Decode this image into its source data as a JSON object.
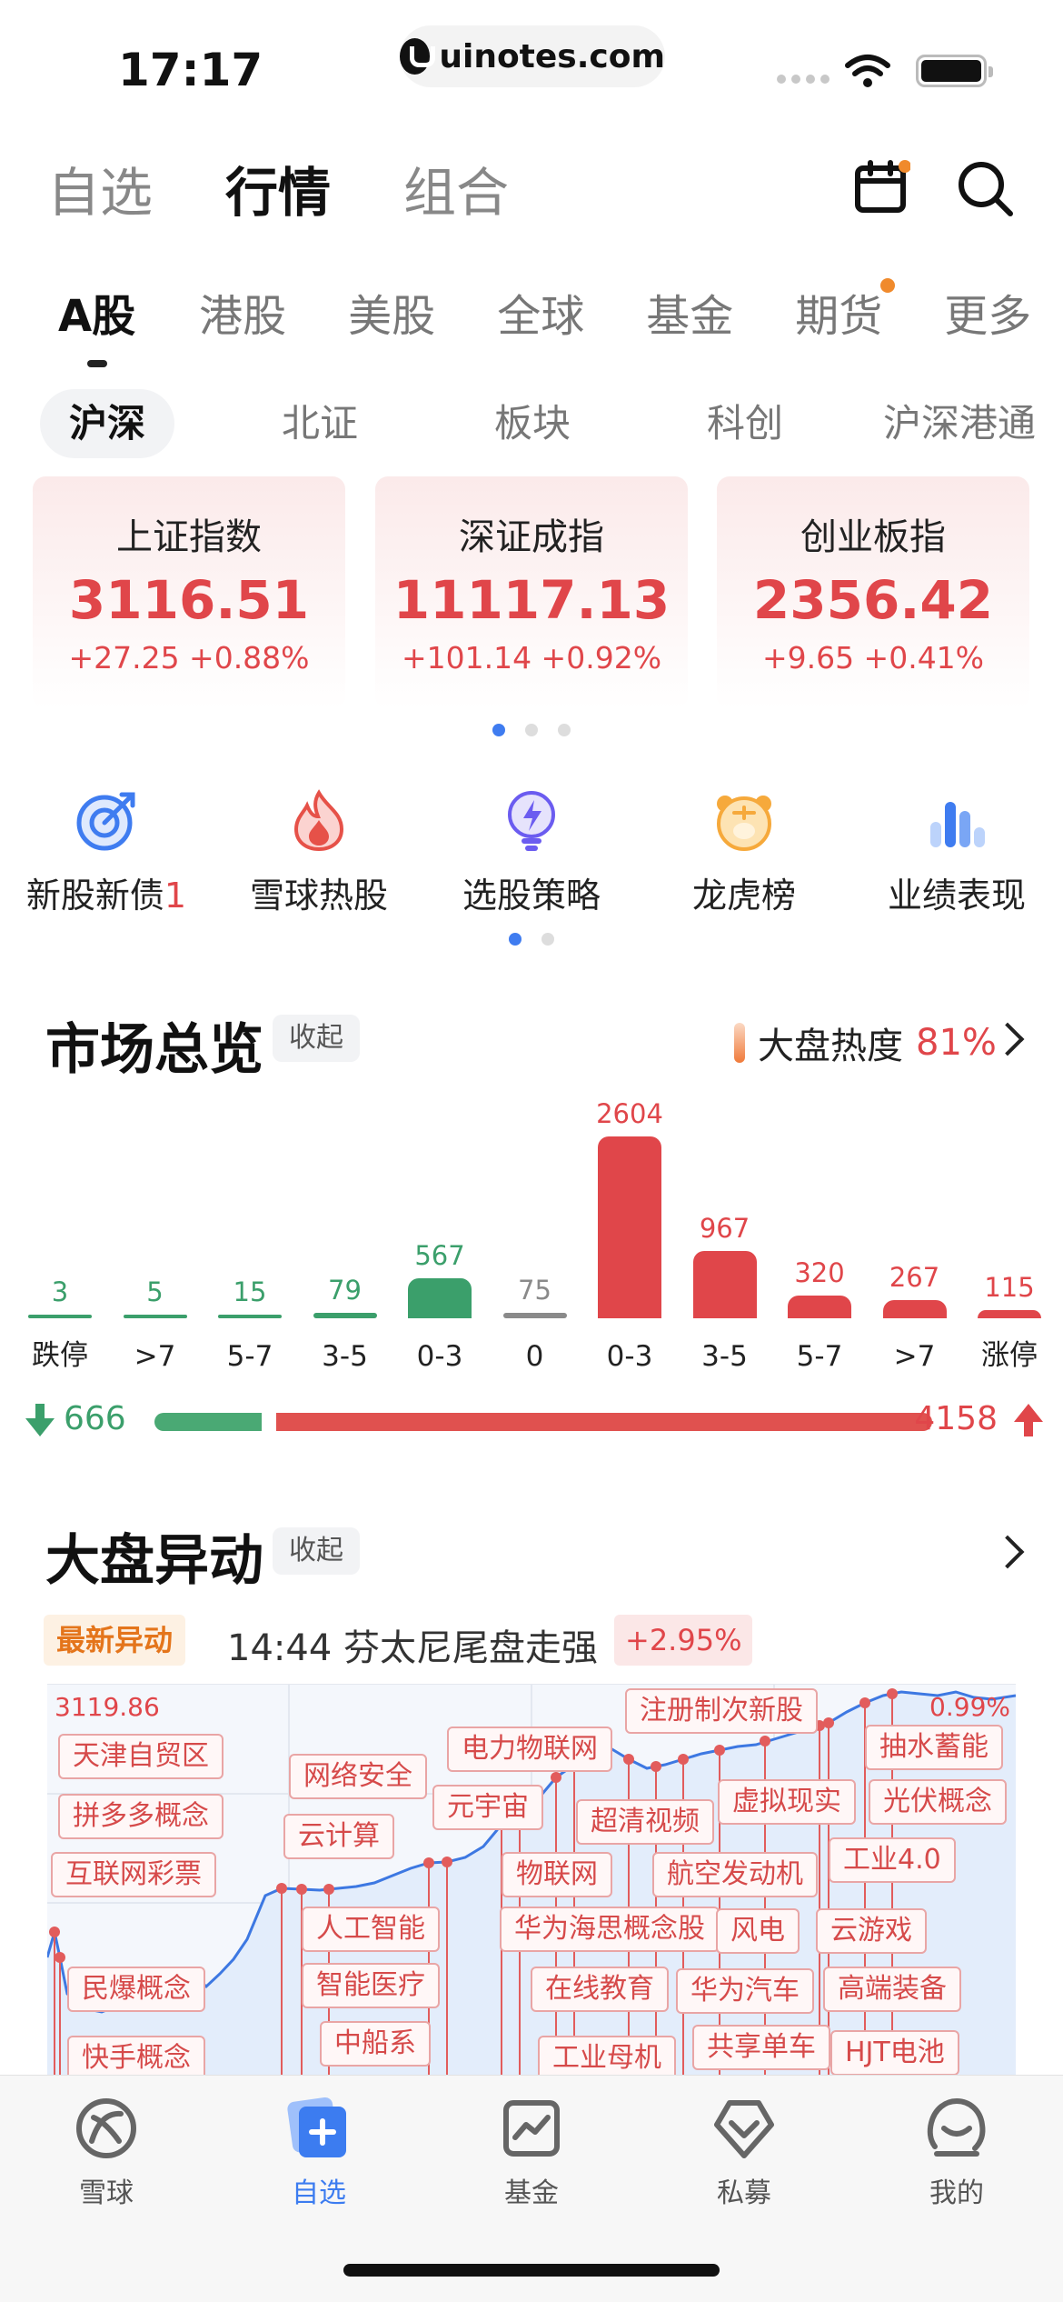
{
  "status": {
    "time": "17:17",
    "url": "uinotes.com"
  },
  "top_nav": [
    "自选",
    "行情",
    "组合"
  ],
  "top_nav_active": 1,
  "market_tabs": [
    "A股",
    "港股",
    "美股",
    "全球",
    "基金",
    "期货",
    "更多"
  ],
  "market_tab_active": 0,
  "sub_tabs": [
    "沪深",
    "北证",
    "板块",
    "科创",
    "沪深港通"
  ],
  "sub_tab_active": 0,
  "indices": [
    {
      "name": "上证指数",
      "value": "3116.51",
      "change": "+27.25 +0.88%"
    },
    {
      "name": "深证成指",
      "value": "11117.13",
      "change": "+101.14 +0.92%"
    },
    {
      "name": "创业板指",
      "value": "2356.42",
      "change": "+9.65 +0.41%"
    }
  ],
  "quick_entries": [
    {
      "label": "新股新债",
      "badge": "1"
    },
    {
      "label": "雪球热股",
      "badge": ""
    },
    {
      "label": "选股策略",
      "badge": ""
    },
    {
      "label": "龙虎榜",
      "badge": ""
    },
    {
      "label": "业绩表现",
      "badge": ""
    }
  ],
  "market_overview": {
    "title": "市场总览",
    "collapse_label": "收起",
    "heat_label": "大盘热度",
    "heat_value": "81%",
    "distribution": {
      "categories": [
        "跌停",
        ">7",
        "5-7",
        "3-5",
        "0-3",
        "0",
        "0-3",
        "3-5",
        "5-7",
        ">7",
        "涨停"
      ],
      "values": [
        3,
        5,
        15,
        79,
        567,
        75,
        2604,
        967,
        320,
        267,
        115
      ],
      "kinds": [
        "down",
        "down",
        "down",
        "down",
        "down",
        "flat",
        "up",
        "up",
        "up",
        "up",
        "up"
      ]
    },
    "down_count": "666",
    "up_count": "4158",
    "down_fraction": 0.138
  },
  "movement": {
    "title": "大盘异动",
    "collapse_label": "收起",
    "latest_tag": "最新异动",
    "latest_text": "14:44 芬太尼尾盘走强",
    "latest_change": "+2.95%",
    "chart_high": "3119.86",
    "chart_pct": "0.99%",
    "tags": [
      "天津自贸区",
      "拼多多概念",
      "互联网彩票",
      "民爆概念",
      "快手概念",
      "网络安全",
      "云计算",
      "人工智能",
      "智能医疗",
      "中船系",
      "电力物联网",
      "元宇宙",
      "物联网",
      "华为海思概念股",
      "超清视频",
      "在线教育",
      "工业母机",
      "注册制次新股",
      "虚拟现实",
      "航空发动机",
      "风电",
      "华为汽车",
      "共享单车",
      "抽水蓄能",
      "光伏概念",
      "工业4.0",
      "云游戏",
      "高端装备",
      "HJT电池"
    ]
  },
  "bottom_tabs": [
    "雪球",
    "自选",
    "基金",
    "私募",
    "我的"
  ],
  "bottom_tab_active": 1,
  "colors": {
    "up": "#e0464a",
    "down": "#3b9f6b",
    "flat": "#8a8a8a",
    "accent": "#3c7cf0",
    "badge": "#f08a2c"
  }
}
